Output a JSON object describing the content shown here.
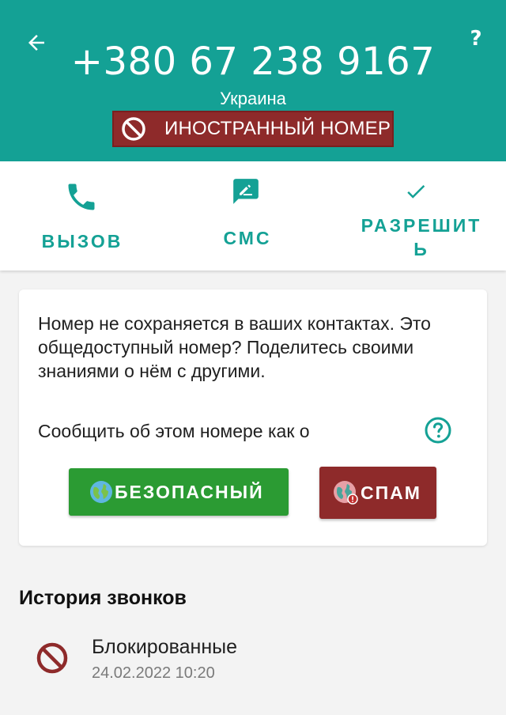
{
  "header": {
    "phone_number": "+380 67 238 9167",
    "country": "Украина",
    "badge_text": "ИНОСТРАННЫЙ НОМЕР",
    "help_label": "?"
  },
  "actions": [
    {
      "label": "ВЫЗОВ",
      "icon": "phone-icon"
    },
    {
      "label": "СМС",
      "icon": "sms-icon"
    },
    {
      "label_line1": "РАЗРЕШИТ",
      "label_line2": "Ь",
      "icon": "check-icon"
    }
  ],
  "card": {
    "description": "Номер не сохраняется в ваших контактах. Это общедоступный номер? Поделитесь своими знаниями о нём с другими.",
    "report_label": "Сообщить об этом номере как о",
    "safe_button": "БЕЗОПАСНЫЙ",
    "spam_button": "СПАМ"
  },
  "history": {
    "title": "История звонков",
    "items": [
      {
        "type": "Блокированные",
        "time": "24.02.2022 10:20"
      }
    ]
  },
  "colors": {
    "teal": "#14a195",
    "badge_red": "#8e2a2a",
    "safe_green": "#2b9b33",
    "spam_red": "#8e2a2a"
  }
}
